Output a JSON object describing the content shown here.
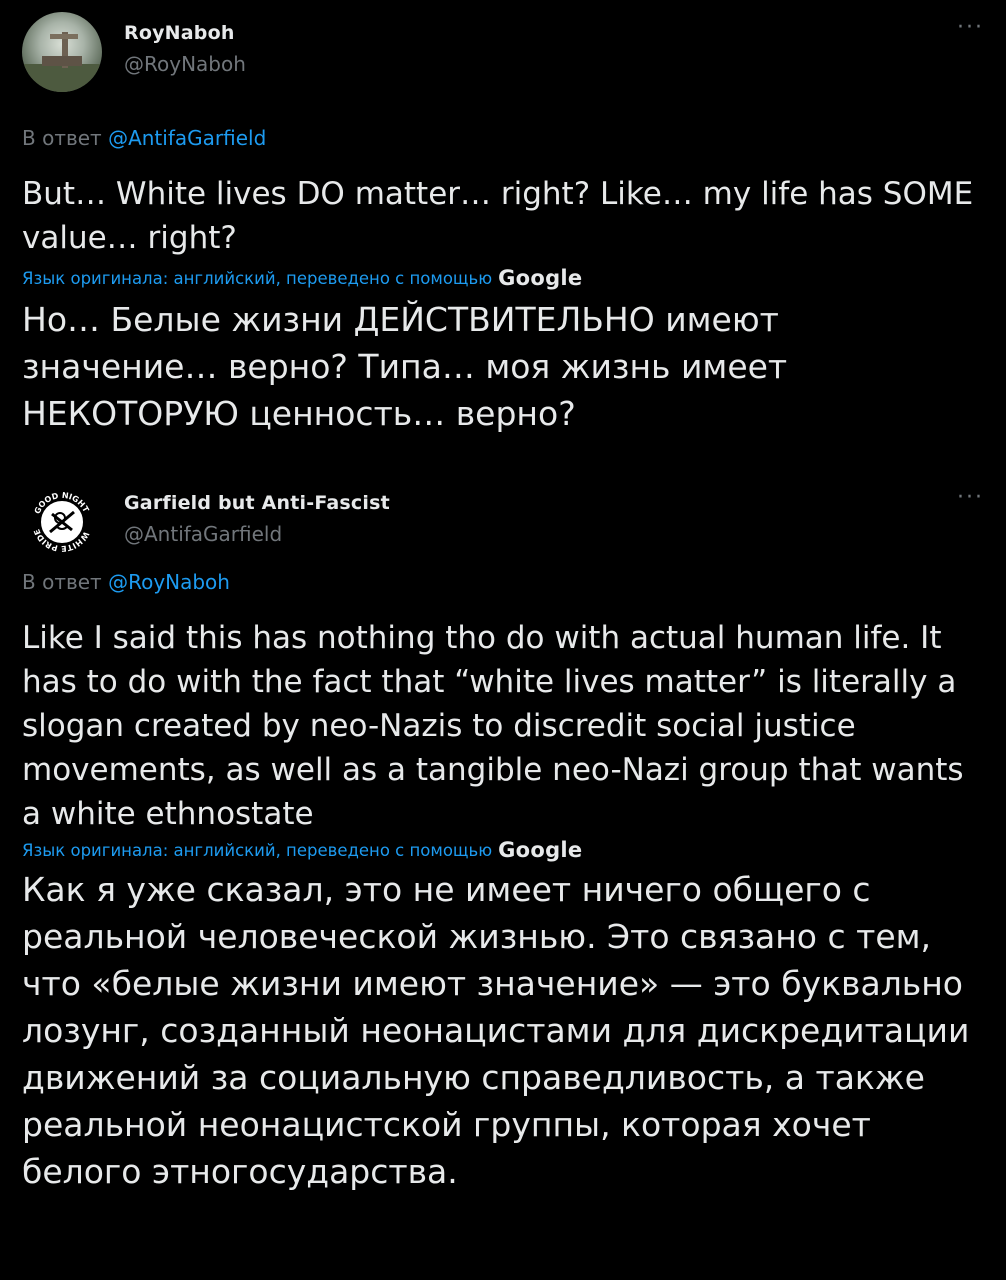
{
  "tweets": [
    {
      "display_name": "RoyNaboh",
      "handle": "@RoyNaboh",
      "more_icon": "more-horizontal-icon",
      "reply_prefix": "В ответ",
      "reply_to": "@AntifaGarfield",
      "text": "But… White lives DO matter… right? Like… my life has SOME value… right?",
      "translation_note": "Язык оригинала: английский, переведено с помощью",
      "translation_provider": "Google",
      "translation": "Но… Белые жизни ДЕЙСТВИТЕЛЬНО имеют значение… верно? Типа… моя жизнь имеет НЕКОТОРУЮ ценность… верно?"
    },
    {
      "display_name": "Garfield but Anti-Fascist",
      "handle": "@AntifaGarfield",
      "more_icon": "more-horizontal-icon",
      "avatar_badge_text": "GOOD NIGHT WHITE PRIDE",
      "reply_prefix": "В ответ",
      "reply_to": "@RoyNaboh",
      "text": "Like I said this has nothing tho do with actual human life. It has to do with the fact that “white lives matter” is literally a slogan created by neo-Nazis to discredit social justice movements, as well as a tangible neo-Nazi group that wants a white ethnostate",
      "translation_note": "Язык оригинала: английский, переведено с помощью",
      "translation_provider": "Google",
      "translation": "Как я уже сказал, это не имеет ничего общего с реальной человеческой жизнью. Это связано с тем, что «белые жизни имеют значение» — это буквально лозунг, созданный неонацистами для дискредитации движений за социальную справедливость, а также реальной неонацистской группы, которая хочет белого этногосударства."
    }
  ]
}
